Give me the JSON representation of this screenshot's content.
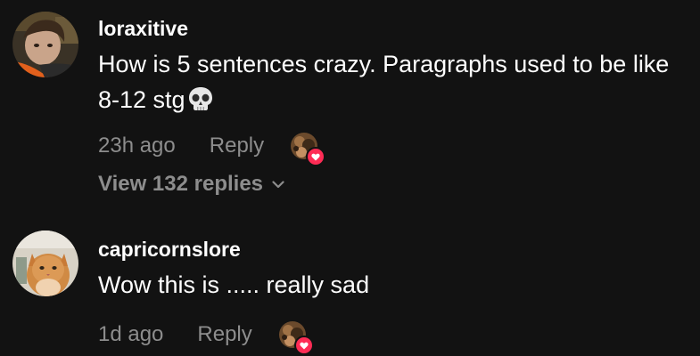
{
  "colors": {
    "background": "#121212",
    "primary_text": "#ffffff",
    "secondary_text": "#8d8d8d",
    "heart_badge": "#fe2c55"
  },
  "comments": [
    {
      "username": "loraxitive",
      "text": "How is 5 sentences crazy. Paragraphs used to be like 8-12 stg",
      "emoji_icon": "skull-icon",
      "time": "23h ago",
      "reply_label": "Reply",
      "creator_liked_icon": "heart-icon",
      "view_replies_label": "View 132 replies",
      "view_replies_icon": "chevron-down-icon"
    },
    {
      "username": "capricornslore",
      "text": "Wow this is ..... really sad",
      "time": "1d ago",
      "reply_label": "Reply",
      "creator_liked_icon": "heart-icon"
    }
  ]
}
